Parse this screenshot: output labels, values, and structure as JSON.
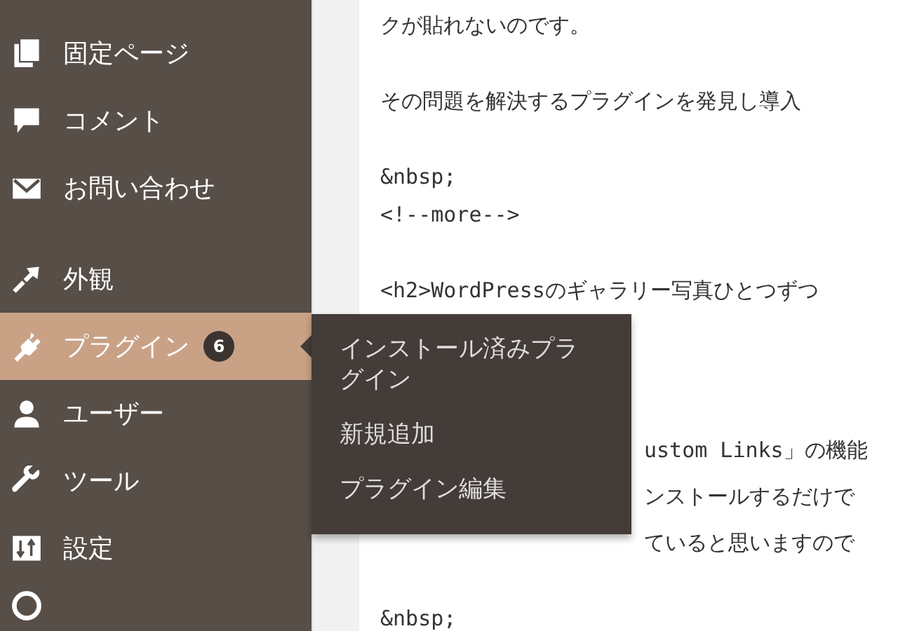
{
  "sidebar": {
    "items": [
      {
        "kind": "menu",
        "label": "固定ページ",
        "selected": false
      },
      {
        "kind": "menu",
        "label": "コメント",
        "selected": false
      },
      {
        "kind": "menu",
        "label": "お問い合わせ",
        "selected": false
      },
      {
        "kind": "separator"
      },
      {
        "kind": "menu",
        "label": "外観",
        "selected": false
      },
      {
        "kind": "menu",
        "label": "プラグイン",
        "selected": true,
        "badge": "6"
      },
      {
        "kind": "menu",
        "label": "ユーザー",
        "selected": false
      },
      {
        "kind": "menu",
        "label": "ツール",
        "selected": false
      },
      {
        "kind": "menu",
        "label": "設定",
        "selected": false
      }
    ]
  },
  "flyout": {
    "items": [
      "インストール済みプラグイン",
      "新規追加",
      "プラグイン編集"
    ]
  },
  "editor": {
    "lines": [
      {
        "text": "クが貼れないのです。",
        "kind": "full"
      },
      {
        "kind": "blank"
      },
      {
        "text": "その問題を解決するプラグインを発見し導入",
        "kind": "full"
      },
      {
        "kind": "blank"
      },
      {
        "text": "&nbsp;",
        "kind": "full"
      },
      {
        "text": "<!--more-->",
        "kind": "full"
      },
      {
        "kind": "blank"
      },
      {
        "text": "<h2>WordPressのギャラリー写真ひとつずつ",
        "kind": "full"
      },
      {
        "kind": "blank"
      },
      {
        "kind": "blank"
      },
      {
        "kind": "blank"
      },
      {
        "text": "ustom Links」の機能",
        "kind": "partial"
      },
      {
        "text": "ンストールするだけで",
        "kind": "partial"
      },
      {
        "text": "ていると思いますので",
        "kind": "partial"
      },
      {
        "kind": "blank"
      },
      {
        "text": "&nbsp;",
        "kind": "full"
      }
    ]
  }
}
